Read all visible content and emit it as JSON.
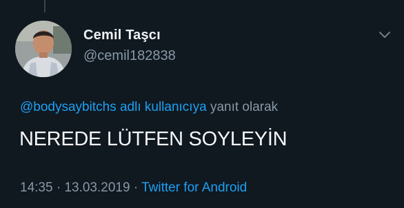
{
  "tweet": {
    "author": {
      "display_name": "Cemil Taşcı",
      "handle": "@cemil182838"
    },
    "reply_to": {
      "mention": "@bodysaybitchs adlı kullanıcıya",
      "suffix": "yanıt olarak"
    },
    "text": "NEREDE LÜTFEN SOYLEYİN",
    "meta": {
      "time": "14:35",
      "separator": "·",
      "date": "13.03.2019",
      "source": "Twitter for Android"
    },
    "icons": {
      "menu": "chevron-down-icon"
    },
    "colors": {
      "background": "#101820",
      "link": "#1da1f2",
      "secondary_text": "#8899a6",
      "primary_text": "#e8ecef"
    }
  }
}
